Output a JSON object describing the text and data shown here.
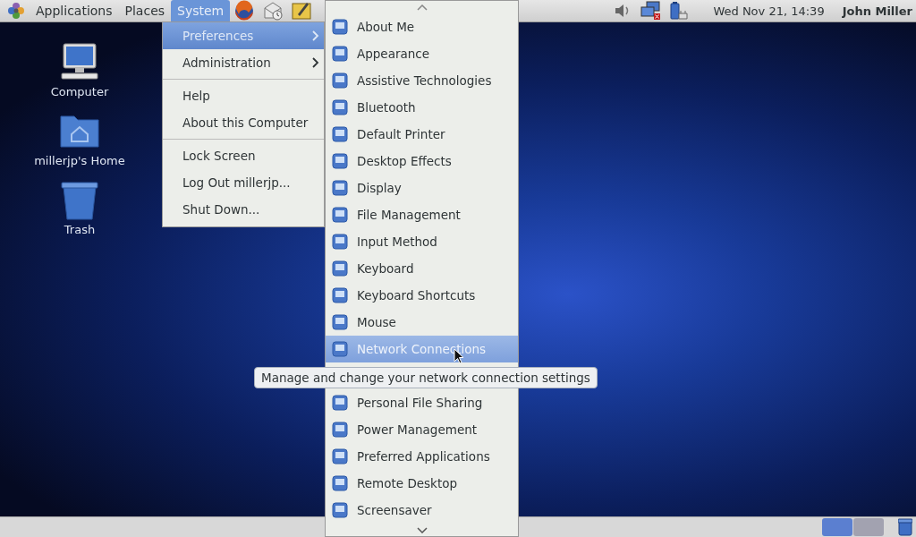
{
  "top_panel": {
    "menus": [
      {
        "label": "Applications",
        "selected": false
      },
      {
        "label": "Places",
        "selected": false
      },
      {
        "label": "System",
        "selected": true
      }
    ],
    "clock": "Wed Nov 21, 14:39",
    "user": "John Miller"
  },
  "desktop_icons": [
    {
      "label": "Computer",
      "kind": "computer"
    },
    {
      "label": "millerjp's Home",
      "kind": "folder"
    },
    {
      "label": "Trash",
      "kind": "trash"
    }
  ],
  "system_menu": {
    "items": [
      {
        "kind": "item",
        "label": "Preferences",
        "submenu": true,
        "selected": true
      },
      {
        "kind": "item",
        "label": "Administration",
        "submenu": true,
        "selected": false
      },
      {
        "kind": "separator"
      },
      {
        "kind": "item",
        "label": "Help",
        "submenu": false,
        "selected": false
      },
      {
        "kind": "item",
        "label": "About this Computer",
        "submenu": false,
        "selected": false
      },
      {
        "kind": "separator"
      },
      {
        "kind": "item",
        "label": "Lock Screen",
        "submenu": false,
        "selected": false
      },
      {
        "kind": "item",
        "label": "Log Out millerjp...",
        "submenu": false,
        "selected": false
      },
      {
        "kind": "item",
        "label": "Shut Down...",
        "submenu": false,
        "selected": false
      }
    ]
  },
  "preferences_menu": {
    "items": [
      {
        "label": "About Me",
        "selected": false
      },
      {
        "label": "Appearance",
        "selected": false
      },
      {
        "label": "Assistive Technologies",
        "selected": false
      },
      {
        "label": "Bluetooth",
        "selected": false
      },
      {
        "label": "Default Printer",
        "selected": false
      },
      {
        "label": "Desktop Effects",
        "selected": false
      },
      {
        "label": "Display",
        "selected": false
      },
      {
        "label": "File Management",
        "selected": false
      },
      {
        "label": "Input Method",
        "selected": false
      },
      {
        "label": "Keyboard",
        "selected": false
      },
      {
        "label": "Keyboard Shortcuts",
        "selected": false
      },
      {
        "label": "Mouse",
        "selected": false
      },
      {
        "label": "Network Connections",
        "selected": true,
        "tooltip": "Manage and change your network connection settings"
      },
      {
        "label": "Personal File Sharing",
        "selected": false
      },
      {
        "label": "Power Management",
        "selected": false
      },
      {
        "label": "Preferred Applications",
        "selected": false
      },
      {
        "label": "Remote Desktop",
        "selected": false
      },
      {
        "label": "Screensaver",
        "selected": false
      }
    ]
  },
  "bottom_panel": {
    "workspaces": [
      {
        "selected": true
      },
      {
        "selected": false
      }
    ]
  }
}
